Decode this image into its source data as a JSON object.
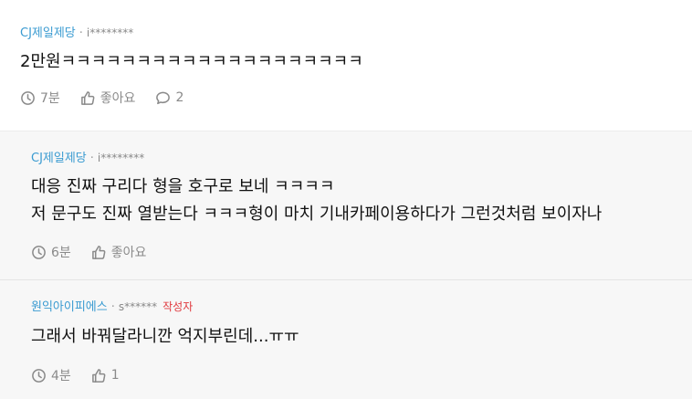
{
  "comments": [
    {
      "nickname": "CJ제일제당",
      "separator": "·",
      "user_id": "i********",
      "badge": "",
      "lines": [
        "2만원ㅋㅋㅋㅋㅋㅋㅋㅋㅋㅋㅋㅋㅋㅋㅋㅋㅋㅋㅋㅋ"
      ],
      "time": "7분",
      "like_label": "좋아요",
      "reply_count": "2"
    },
    {
      "nickname": "CJ제일제당",
      "separator": "·",
      "user_id": "i********",
      "badge": "",
      "lines": [
        "대응 진짜 구리다 형을 호구로 보네 ㅋㅋㅋㅋ",
        "저 문구도 진짜 열받는다 ㅋㅋㅋ형이 마치 기내카페이용하다가 그런것처럼 보이자나"
      ],
      "time": "6분",
      "like_label": "좋아요"
    },
    {
      "nickname": "원익아이피에스",
      "separator": "·",
      "user_id": "s******",
      "badge": "작성자",
      "lines": [
        "그래서 바꿔달라니깐 억지부린데...ㅠㅠ"
      ],
      "time": "4분",
      "like_label": "1"
    }
  ]
}
